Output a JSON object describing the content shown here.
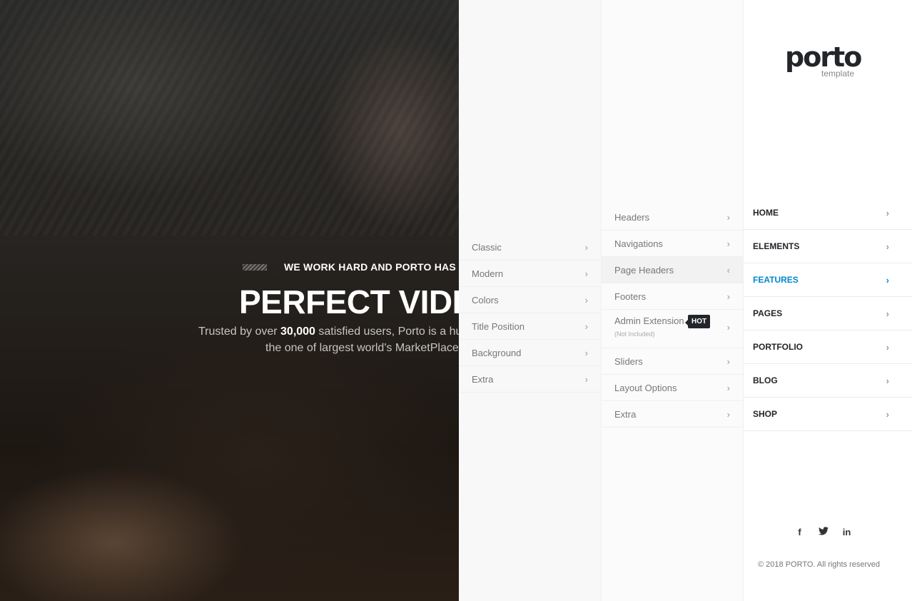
{
  "hero": {
    "subtitle": "WE WORK HARD AND PORTO HAS",
    "headline": "PERFECT VIDEO",
    "tagline_pre": "Trusted by over",
    "tagline_count": "30,000",
    "tagline_post": "satisfied users, Porto is a hu",
    "tagline_line2": "the one of largest world's MarketPlace"
  },
  "logo": {
    "text": "porto",
    "sub": "template"
  },
  "menu_level1": [
    {
      "label": "HOME"
    },
    {
      "label": "ELEMENTS"
    },
    {
      "label": "FEATURES",
      "active": true
    },
    {
      "label": "PAGES"
    },
    {
      "label": "PORTFOLIO"
    },
    {
      "label": "BLOG"
    },
    {
      "label": "SHOP"
    }
  ],
  "menu_level2": [
    {
      "label": "Headers"
    },
    {
      "label": "Navigations"
    },
    {
      "label": "Page Headers",
      "active": true
    },
    {
      "label": "Footers"
    },
    {
      "label": "Admin Extension",
      "note": "(Not Included)",
      "badge": "HOT"
    },
    {
      "label": "Sliders"
    },
    {
      "label": "Layout Options"
    },
    {
      "label": "Extra"
    }
  ],
  "menu_level3": [
    {
      "label": "Classic"
    },
    {
      "label": "Modern"
    },
    {
      "label": "Colors"
    },
    {
      "label": "Title Position"
    },
    {
      "label": "Background"
    },
    {
      "label": "Extra"
    }
  ],
  "chevron_right": "›",
  "chevron_left": "‹",
  "social": [
    {
      "icon": "facebook-icon",
      "glyph": "f"
    },
    {
      "icon": "twitter-icon",
      "glyph": "🐦"
    },
    {
      "icon": "linkedin-icon",
      "glyph": "in"
    }
  ],
  "copyright": "© 2018 PORTO. All rights reserved",
  "colors": {
    "accent": "#0088cc",
    "dark": "#222529"
  }
}
